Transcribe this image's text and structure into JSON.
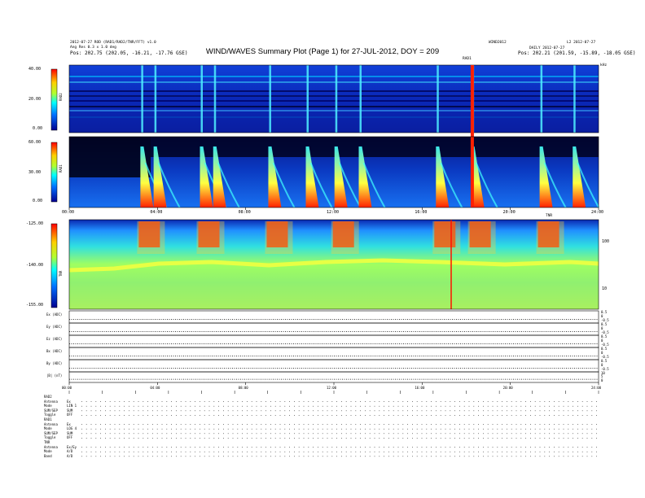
{
  "header": {
    "title": "WIND/WAVES Summary Plot (Page 1) for 27-JUL-2012, DOY = 209",
    "left_line1": "2012-07-27 ROD (RAD1/RAD2/TNR/FFT) v1.0",
    "left_line2": "Ang Res 0.3 x 1.0 deg",
    "left_line3": "Pos:",
    "left_pos": "202.75 (202.05, -16.21, -17.76 GSE)",
    "right_line1": "WIND2012",
    "right_line2": "L2 2012-07-27",
    "right_line3": "DAILY 2012-07-27",
    "right_pos_label": "Pos:",
    "right_pos": "202.21 (201.59, -15.89, -18.05 GSE)",
    "tnr_top_label": "TNR",
    "rad1_top_label": "RAD1",
    "tnr_unit": "kHz"
  },
  "chart_data": [
    {
      "type": "heatmap",
      "panel": "RAD2",
      "ylabel": "RAD2",
      "ytick_labels": [
        "40.00",
        "20.00",
        "0.00"
      ],
      "ylim": [
        0,
        40
      ],
      "bursts_hours": [
        3.3,
        3.9,
        6.0,
        6.6,
        9.1,
        10.8,
        12.1,
        13.2,
        16.7,
        18.3,
        21.4,
        22.9
      ]
    },
    {
      "type": "heatmap",
      "panel": "RAD1",
      "ylabel": "RAD1",
      "ytick_labels": [
        "60.00",
        "30.00",
        "0.00"
      ],
      "ylim": [
        0,
        60
      ],
      "x_ticks": [
        "00:00",
        "04:00",
        "08:00",
        "12:00",
        "16:00",
        "20:00",
        "24:00"
      ]
    },
    {
      "type": "heatmap",
      "panel": "TNR",
      "ylabel": "TNR",
      "ytick_labels": [
        "-125.00",
        "-140.00",
        "-155.00"
      ],
      "ylim": [
        -155,
        -125
      ],
      "right_ticks": [
        "100",
        "10"
      ],
      "x_ticks": [
        "00:00",
        "04:00",
        "08:00",
        "12:00",
        "16:00",
        "20:00",
        "24:00"
      ]
    },
    {
      "type": "line",
      "panel": "FFT",
      "rows": [
        {
          "label": "Ex (ADC)",
          "right_ticks": [
            "0.5",
            "0",
            "-0.5"
          ]
        },
        {
          "label": "Ey (ADC)",
          "right_ticks": [
            "0.5",
            "0",
            "-0.5"
          ]
        },
        {
          "label": "Ez (ADC)",
          "right_ticks": [
            "0.5",
            "0",
            "-0.5"
          ]
        },
        {
          "label": "Bx (ADC)",
          "right_ticks": [
            "0.5",
            "0",
            "-0.5"
          ]
        },
        {
          "label": "By (ADC)",
          "right_ticks": [
            "0.5",
            "0",
            "-0.5"
          ]
        },
        {
          "label": "|B| (nT)",
          "right_ticks": [
            "10",
            "5",
            "0"
          ]
        }
      ],
      "x_ticks": [
        "00:00",
        "04:00",
        "08:00",
        "12:00",
        "16:00",
        "20:00",
        "24:00"
      ]
    }
  ],
  "footer": {
    "rows": [
      {
        "k": "RAD2",
        "v": ""
      },
      {
        "k": "Antenna",
        "v": "Ex"
      },
      {
        "k": "Mode",
        "v": "LIN 1"
      },
      {
        "k": "SUM/SEP",
        "v": "SUM"
      },
      {
        "k": "Toggle",
        "v": "OFF"
      },
      {
        "k": "RAD1",
        "v": ""
      },
      {
        "k": "Antenna",
        "v": "Ex"
      },
      {
        "k": "Mode",
        "v": "LOG 4"
      },
      {
        "k": "SUM/SEP",
        "v": "SUM"
      },
      {
        "k": "Toggle",
        "v": "OFF"
      },
      {
        "k": "TNR",
        "v": ""
      },
      {
        "k": "Antenna",
        "v": "Ex/Ey"
      },
      {
        "k": "Mode",
        "v": "A/D"
      },
      {
        "k": "Band",
        "v": "A/D"
      }
    ]
  },
  "colors": {
    "low": "#0010a0",
    "mid": "#30c0ff",
    "high": "#e01000",
    "tnr_band": "#c0ff40"
  }
}
